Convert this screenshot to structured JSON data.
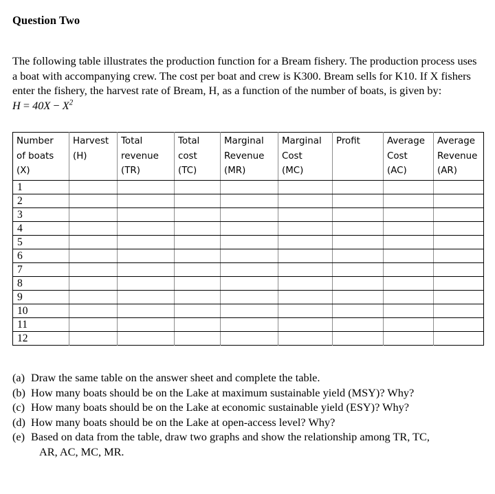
{
  "document": {
    "title": "Question Two",
    "intro": {
      "part1": "The following table illustrates the production function for a Bream fishery. The production process uses a boat with accompanying crew. The cost per boat and crew is K300. Bream sells for K10. If X fishers enter the fishery, the harvest rate of Bream, H, as a function of the number of boats, is given by:",
      "formula_plain": "H = 40X − X²",
      "formula_var_h": "H",
      "formula_equals": "=",
      "formula_term1": "40X",
      "formula_minus": "−",
      "formula_term2_base": "X",
      "formula_term2_exp": "2"
    },
    "table": {
      "headers": [
        "Number\nof boats\n(X)",
        "Harvest\n(H)",
        "Total\nrevenue\n(TR)",
        "Total\ncost\n(TC)",
        "Marginal\nRevenue\n(MR)",
        "Marginal\nCost\n(MC)",
        "Profit",
        "Average\nCost\n(AC)",
        "Average\nRevenue\n(AR)"
      ],
      "rows": [
        [
          "1",
          "",
          "",
          "",
          "",
          "",
          "",
          "",
          ""
        ],
        [
          "2",
          "",
          "",
          "",
          "",
          "",
          "",
          "",
          ""
        ],
        [
          "3",
          "",
          "",
          "",
          "",
          "",
          "",
          "",
          ""
        ],
        [
          "4",
          "",
          "",
          "",
          "",
          "",
          "",
          "",
          ""
        ],
        [
          "5",
          "",
          "",
          "",
          "",
          "",
          "",
          "",
          ""
        ],
        [
          "6",
          "",
          "",
          "",
          "",
          "",
          "",
          "",
          ""
        ],
        [
          "7",
          "",
          "",
          "",
          "",
          "",
          "",
          "",
          ""
        ],
        [
          "8",
          "",
          "",
          "",
          "",
          "",
          "",
          "",
          ""
        ],
        [
          "9",
          "",
          "",
          "",
          "",
          "",
          "",
          "",
          ""
        ],
        [
          "10",
          "",
          "",
          "",
          "",
          "",
          "",
          "",
          ""
        ],
        [
          "11",
          "",
          "",
          "",
          "",
          "",
          "",
          "",
          ""
        ],
        [
          "12",
          "",
          "",
          "",
          "",
          "",
          "",
          "",
          ""
        ]
      ]
    },
    "questions": [
      {
        "marker": "(a)",
        "text": "Draw the same table on the answer sheet and complete the table.",
        "continuation": ""
      },
      {
        "marker": "(b)",
        "text": "How many boats should be on the Lake at maximum sustainable yield (MSY)? Why?",
        "continuation": ""
      },
      {
        "marker": "(c)",
        "text": "How many boats should be on the Lake at economic sustainable yield (ESY)? Why?",
        "continuation": ""
      },
      {
        "marker": "(d)",
        "text": "How many boats should be on the Lake at open-access level? Why?",
        "continuation": ""
      },
      {
        "marker": "(e)",
        "text": "Based on data from the table, draw two graphs and show the relationship among TR, TC,",
        "continuation": "AR, AC, MC, MR."
      }
    ]
  },
  "colors": {
    "text": "#000000",
    "page_background": "#ffffff",
    "table_outer_border": "#000000",
    "table_row_line": "#000000",
    "table_column_line": "#8c8c8c"
  }
}
